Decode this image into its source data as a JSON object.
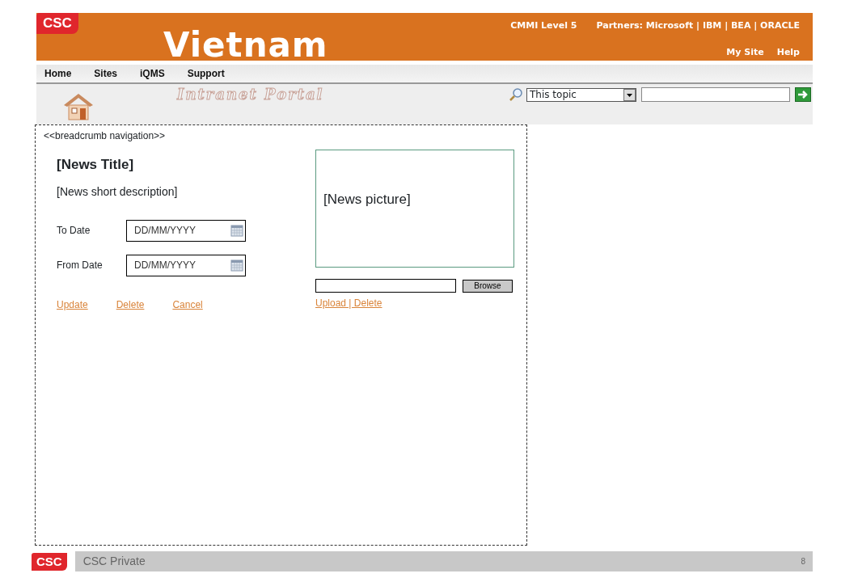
{
  "header": {
    "logo": "CSC",
    "title": "Vietnam",
    "cmmi": "CMMI Level 5",
    "partners": "Partners: Microsoft | IBM | BEA | ORACLE",
    "links": [
      "My Site",
      "Help"
    ]
  },
  "nav": [
    "Home",
    "Sites",
    "iQMS",
    "Support"
  ],
  "portal": {
    "title": "Intranet Portal",
    "search_scope": "This topic"
  },
  "content": {
    "breadcrumb": "<<breadcrumb navigation>>",
    "news_title": "[News Title]",
    "description": "[News short description]",
    "dates": [
      {
        "label": "To Date",
        "placeholder": "DD/MM/YYYY"
      },
      {
        "label": "From Date",
        "placeholder": "DD/MM/YYYY"
      }
    ],
    "actions": [
      "Update",
      "Delete",
      "Cancel"
    ],
    "picture": "[News picture]",
    "browse": "Browse",
    "upload_links": "Upload | Delete"
  },
  "footer": {
    "logo": "CSC",
    "label": "CSC Private",
    "page": "8"
  }
}
